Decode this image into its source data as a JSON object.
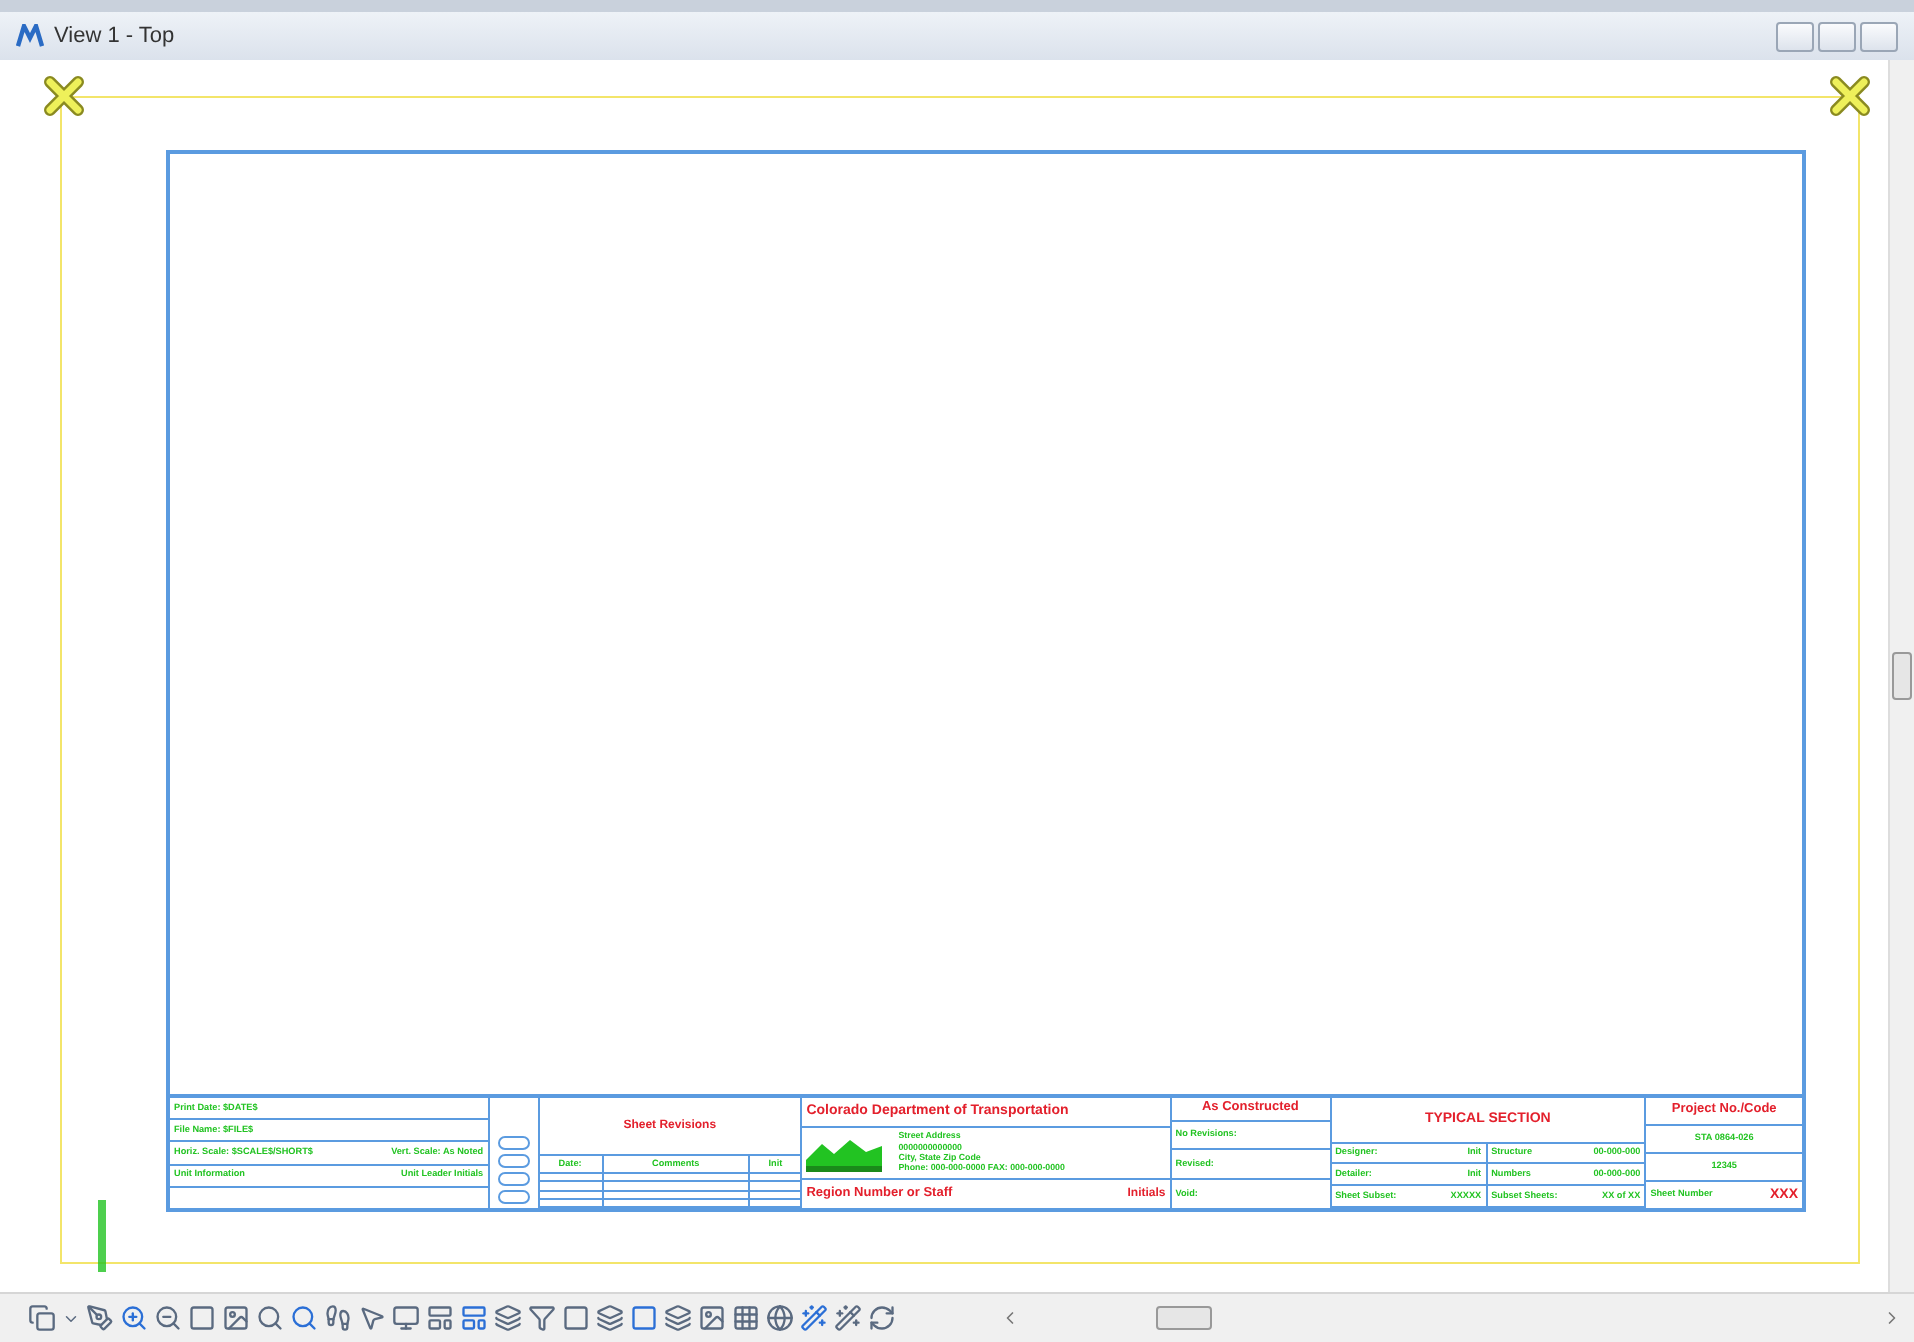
{
  "window": {
    "title": "View 1 - Top"
  },
  "title_block": {
    "info_rows": [
      {
        "label": "Print Date: $DATE$"
      },
      {
        "label": "File Name: $FILE$"
      },
      {
        "label": "Horiz. Scale: $SCALE$/SHORT$",
        "note": "Vert. Scale: As Noted"
      },
      {
        "label": "Unit Information",
        "note": "Unit Leader Initials"
      }
    ],
    "revisions": {
      "title": "Sheet Revisions",
      "columns": [
        "Date:",
        "Comments",
        "Init"
      ]
    },
    "agency": {
      "name": "Colorado Department of Transportation",
      "address_lines": [
        "Street Address",
        "0000000000000",
        "City, State  Zip Code",
        "Phone: 000-000-0000  FAX: 000-000-0000"
      ],
      "region": "Region Number or Staff",
      "initials": "Initials"
    },
    "as_constructed": {
      "title": "As Constructed",
      "rows": [
        "No Revisions:",
        "Revised:",
        "Void:"
      ]
    },
    "sheet_title": "TYPICAL SECTION",
    "details": [
      [
        "Designer:",
        "Init",
        "Structure",
        "00-000-000"
      ],
      [
        "Detailer:",
        "Init",
        "Numbers",
        "00-000-000"
      ],
      [
        "Sheet Subset:",
        "XXXXX",
        "Subset Sheets:",
        "XX of XX"
      ]
    ],
    "project": {
      "title": "Project No./Code",
      "code": "STA 0864-026",
      "number": "12345",
      "sheet_label": "Sheet Number",
      "sheet_number": "XXX"
    }
  }
}
